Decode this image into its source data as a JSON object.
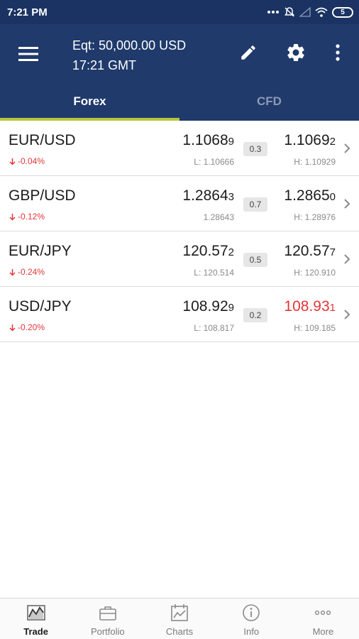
{
  "status_bar": {
    "time": "7:21 PM",
    "battery": "5"
  },
  "header": {
    "equity": "Eqt: 50,000.00 USD",
    "time": "17:21 GMT"
  },
  "tabs": [
    {
      "label": "Forex",
      "active": true
    },
    {
      "label": "CFD",
      "active": false
    }
  ],
  "quotes": [
    {
      "pair": "EUR/USD",
      "change": "-0.04%",
      "bid_main": "1.1068",
      "bid_pip": "9",
      "low": "L: 1.10666",
      "spread": "0.3",
      "ask_main": "1.1069",
      "ask_pip": "2",
      "high": "H: 1.10929"
    },
    {
      "pair": "GBP/USD",
      "change": "-0.12%",
      "bid_main": "1.2864",
      "bid_pip": "3",
      "low": "1.28643",
      "spread": "0.7",
      "ask_main": "1.2865",
      "ask_pip": "0",
      "high": "H: 1.28976"
    },
    {
      "pair": "EUR/JPY",
      "change": "-0.24%",
      "bid_main": "120.57",
      "bid_pip": "2",
      "low": "L: 120.514",
      "spread": "0.5",
      "ask_main": "120.57",
      "ask_pip": "7",
      "high": "H: 120.910"
    },
    {
      "pair": "USD/JPY",
      "change": "-0.20%",
      "bid_main": "108.92",
      "bid_pip": "9",
      "low": "L: 108.817",
      "spread": "0.2",
      "ask_main": "108.93",
      "ask_pip": "1",
      "high": "H: 109.185"
    }
  ],
  "bottom_nav": [
    {
      "label": "Trade",
      "icon": "trade-chart-icon",
      "active": true
    },
    {
      "label": "Portfolio",
      "icon": "briefcase-icon",
      "active": false
    },
    {
      "label": "Charts",
      "icon": "calendar-chart-icon",
      "active": false
    },
    {
      "label": "Info",
      "icon": "info-icon",
      "active": false
    },
    {
      "label": "More",
      "icon": "more-dots-icon",
      "active": false
    }
  ],
  "colors": {
    "header": "#1f3a6b",
    "status_bar": "#1a3363",
    "accent": "#b7c53a",
    "negative": "#e5353a"
  }
}
